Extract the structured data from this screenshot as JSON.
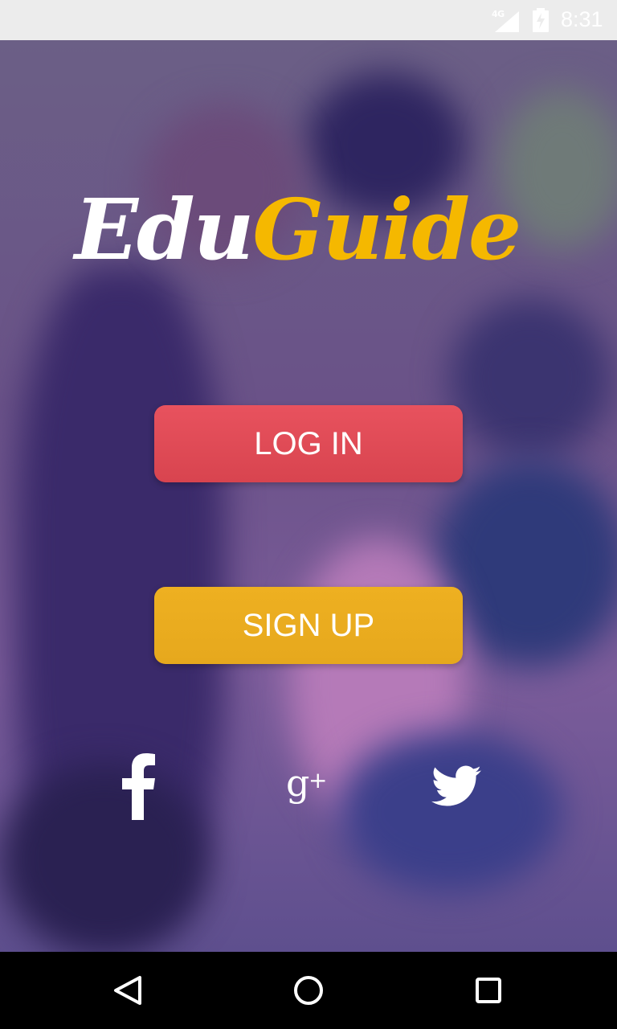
{
  "status_bar": {
    "network": "4G",
    "time": "8:31"
  },
  "logo": {
    "part1": "Edu",
    "part2": "Guide"
  },
  "buttons": {
    "login": "LOG IN",
    "signup": "SIGN UP"
  },
  "social": [
    {
      "icon": "facebook-icon"
    },
    {
      "icon": "google-plus-icon"
    },
    {
      "icon": "twitter-icon"
    }
  ],
  "nav": {
    "back_icon": "back-icon",
    "home_icon": "home-icon",
    "recent_icon": "recent-apps-icon"
  },
  "colors": {
    "login": "#E0505A",
    "signup": "#EAAE20",
    "logo_accent": "#F5B800"
  }
}
